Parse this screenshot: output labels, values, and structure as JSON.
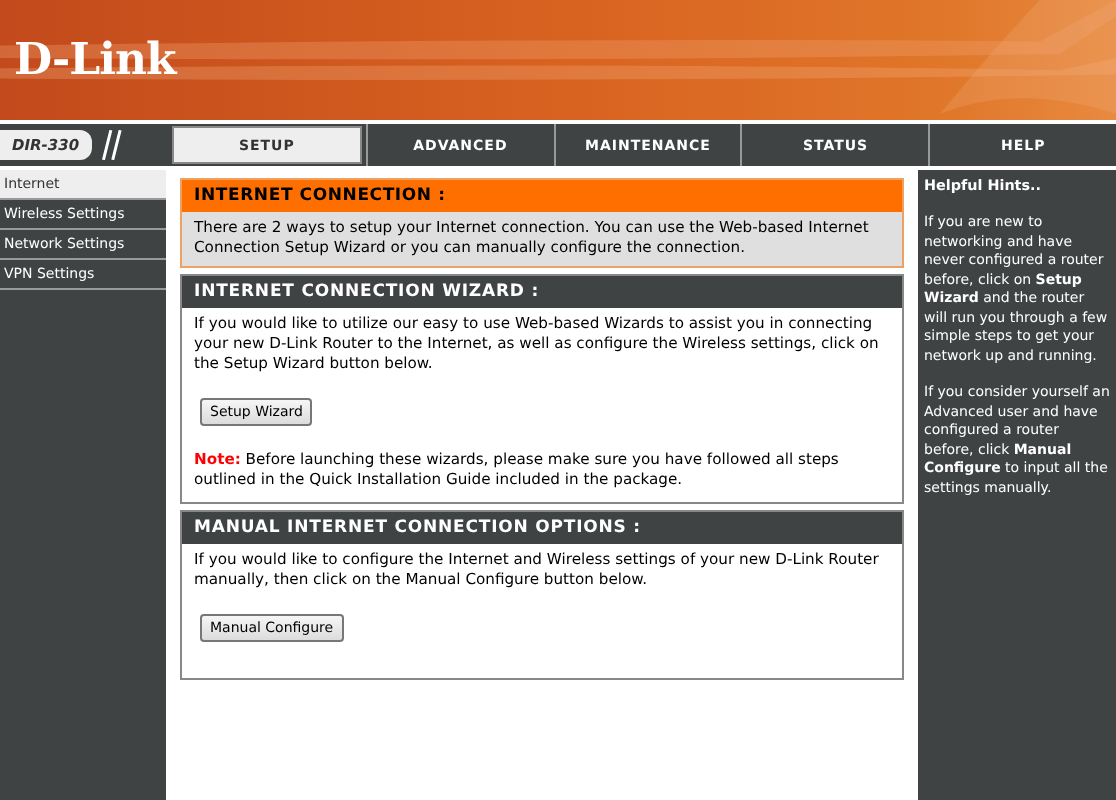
{
  "header": {
    "logo": "D-Link"
  },
  "model": "DIR-330",
  "tabs": [
    {
      "label": "SETUP",
      "selected": true
    },
    {
      "label": "ADVANCED",
      "selected": false
    },
    {
      "label": "MAINTENANCE",
      "selected": false
    },
    {
      "label": "STATUS",
      "selected": false
    },
    {
      "label": "HELP",
      "selected": false
    }
  ],
  "sidebar": {
    "items": [
      {
        "label": "Internet",
        "selected": true
      },
      {
        "label": "Wireless Settings",
        "selected": false
      },
      {
        "label": "Network Settings",
        "selected": false
      },
      {
        "label": "VPN Settings",
        "selected": false
      }
    ]
  },
  "sections": [
    {
      "kind": "intro",
      "title": "INTERNET CONNECTION :",
      "text": "There are 2 ways to setup your Internet connection. You can use the Web-based Internet Connection Setup Wizard or you can manually configure the connection."
    },
    {
      "kind": "panel",
      "title": "INTERNET CONNECTION WIZARD :",
      "text": "If you would like to utilize our easy to use Web-based Wizards to assist you in connecting your new D-Link Router to the Internet, as well as configure the Wireless settings, click on the Setup Wizard button below.",
      "button": "Setup Wizard",
      "note_label": "Note:",
      "note": "Before launching these wizards, please make sure you have followed all steps outlined in the Quick Installation Guide included in the package."
    },
    {
      "kind": "panel",
      "title": "MANUAL INTERNET CONNECTION OPTIONS :",
      "text": "If you would like to configure the Internet and Wireless settings of your new D-Link Router manually, then click on the Manual Configure button below.",
      "button": "Manual Configure"
    }
  ],
  "hints": {
    "title": "Helpful Hints..",
    "paragraphs": [
      "If you are new to networking and have never configured a router before, click on **Setup Wizard** and the router will run you through a few simple steps to get your network up and running.",
      "If you consider yourself an Advanced user and have configured a router before, click **Manual Configure** to input all the settings manually."
    ]
  }
}
